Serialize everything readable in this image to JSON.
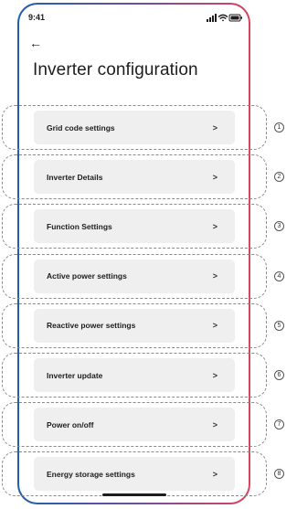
{
  "status_bar": {
    "time": "9:41"
  },
  "header": {
    "title": "Inverter configuration"
  },
  "menu": {
    "items": [
      {
        "label": "Grid code settings",
        "chevron": ">",
        "step": "1"
      },
      {
        "label": "Inverter Details",
        "chevron": ">",
        "step": "2"
      },
      {
        "label": "Function Settings",
        "chevron": ">",
        "step": "3"
      },
      {
        "label": "Active power settings",
        "chevron": ">",
        "step": "4"
      },
      {
        "label": "Reactive power settings",
        "chevron": ">",
        "step": "5"
      },
      {
        "label": "Inverter update",
        "chevron": ">",
        "step": "6"
      },
      {
        "label": "Power on/off",
        "chevron": ">",
        "step": "7"
      },
      {
        "label": "Energy storage settings",
        "chevron": ">",
        "step": "8"
      }
    ]
  },
  "colors": {
    "frame_gradient_left": "#1f5fb0",
    "frame_gradient_right": "#d9455f",
    "button_background": "#efefef"
  }
}
